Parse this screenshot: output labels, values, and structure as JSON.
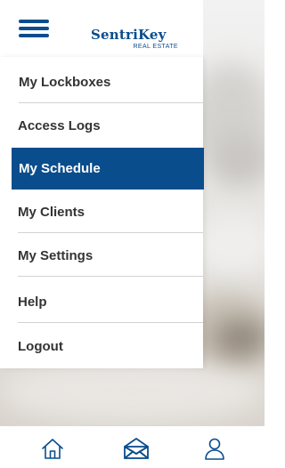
{
  "logo": {
    "name": "SentriKey",
    "subtitle": "REAL ESTATE"
  },
  "menu": {
    "items": [
      {
        "label": "My Lockboxes"
      },
      {
        "label": "Access Logs"
      },
      {
        "label": "My Schedule",
        "active": true
      },
      {
        "label": "My Clients"
      },
      {
        "label": "My Settings"
      },
      {
        "label": "Help"
      },
      {
        "label": "Logout"
      }
    ]
  },
  "tabbar": {
    "icons": [
      "home-icon",
      "envelope-icon",
      "person-icon"
    ]
  },
  "colors": {
    "brand": "#0a4d8c",
    "menu_text": "#333333",
    "active_text": "#ffffff"
  }
}
